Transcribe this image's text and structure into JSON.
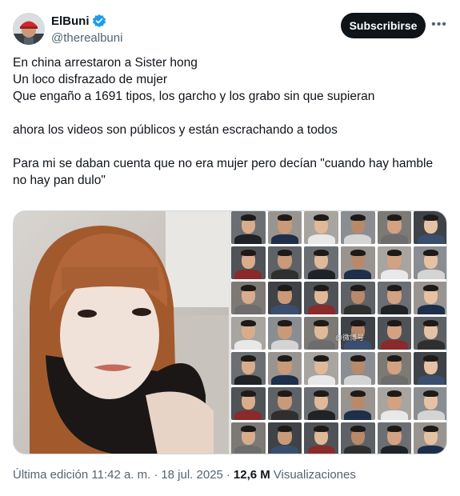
{
  "author": {
    "display_name": "ElBuni",
    "handle": "@therealbuni",
    "verified": true,
    "avatar_icon": "avatar-red-cap"
  },
  "actions": {
    "subscribe_label": "Subscribirse",
    "more_icon": "more-dots-icon"
  },
  "tweet": {
    "lines": [
      "En china arrestaron a Sister hong",
      "Un loco disfrazado de mujer",
      "Que engaño a 1691 tipos, los garcho y los grabo sin que supieran",
      "",
      "ahora los videos son públicos y están escrachando a todos",
      "",
      "Para mi se daban cuenta que no era mujer pero decían \"cuando hay hamble no hay pan dulo\""
    ]
  },
  "media": {
    "watermark": "@微博号"
  },
  "footer": {
    "edited_label": "Última edición 11:42 a. m.",
    "separator": "·",
    "date": "18 jul. 2025",
    "views_count": "12,6 M",
    "views_label": "Visualizaciones"
  },
  "colors": {
    "text_primary": "#0f1419",
    "text_secondary": "#536471",
    "verified_blue": "#1d9bf0",
    "button_bg": "#0f1419"
  }
}
